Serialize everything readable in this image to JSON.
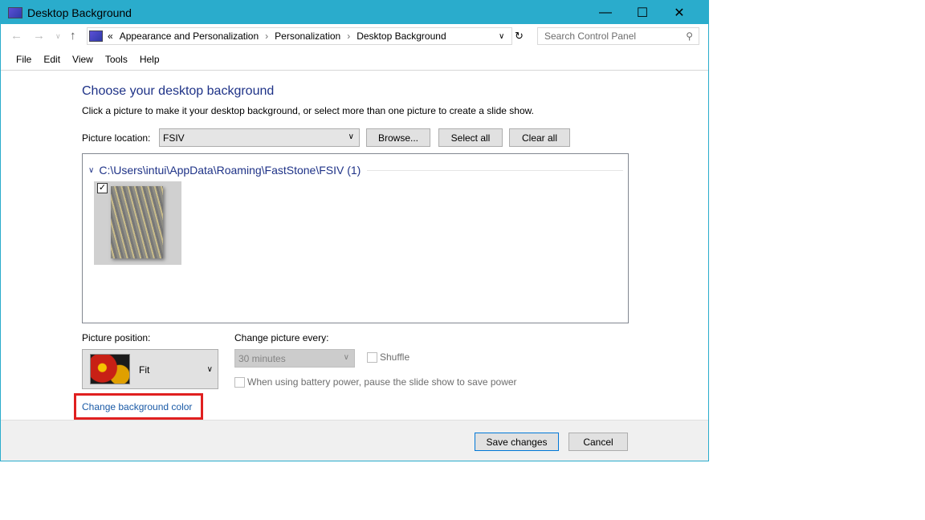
{
  "window": {
    "title": "Desktop Background",
    "icon": "control-panel-icon"
  },
  "address": {
    "overflow": "«",
    "crumbs": [
      "Appearance and Personalization",
      "Personalization",
      "Desktop Background"
    ]
  },
  "search": {
    "placeholder": "Search Control Panel"
  },
  "menu": [
    "File",
    "Edit",
    "View",
    "Tools",
    "Help"
  ],
  "main": {
    "heading": "Choose your desktop background",
    "description": "Click a picture to make it your desktop background, or select more than one picture to create a slide show.",
    "picture_location_label": "Picture location:",
    "picture_location_value": "FSIV",
    "browse": "Browse...",
    "select_all": "Select all",
    "clear_all": "Clear all",
    "group_path": "C:\\Users\\intui\\AppData\\Roaming\\FastStone\\FSIV (1)",
    "thumbnail_checked": true,
    "picture_position_label": "Picture position:",
    "picture_position_value": "Fit",
    "change_every_label": "Change picture every:",
    "change_every_value": "30 minutes",
    "shuffle": "Shuffle",
    "shuffle_checked": false,
    "battery": "When using battery power, pause the slide show to save power",
    "battery_checked": false,
    "change_color_link": "Change background color"
  },
  "footer": {
    "save": "Save changes",
    "cancel": "Cancel"
  },
  "colors": {
    "titlebar": "#2aaccc",
    "heading": "#1e3287",
    "link": "#1a5aa6",
    "highlight": "#e02020"
  }
}
